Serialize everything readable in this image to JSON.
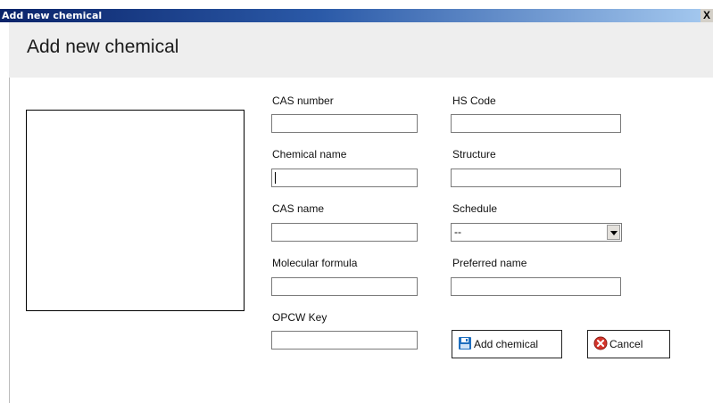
{
  "window": {
    "title": "Add new chemical",
    "close_glyph": "X"
  },
  "header": {
    "title": "Add new chemical"
  },
  "form": {
    "cas_number": {
      "label": "CAS number",
      "value": ""
    },
    "hs_code": {
      "label": "HS Code",
      "value": ""
    },
    "chemical_name": {
      "label": "Chemical name",
      "value": ""
    },
    "structure": {
      "label": "Structure",
      "value": ""
    },
    "cas_name": {
      "label": "CAS name",
      "value": ""
    },
    "schedule": {
      "label": "Schedule",
      "selected": "--"
    },
    "molecular_formula": {
      "label": "Molecular formula",
      "value": ""
    },
    "preferred_name": {
      "label": "Preferred name",
      "value": ""
    },
    "opcw_key": {
      "label": "OPCW Key",
      "value": ""
    }
  },
  "buttons": {
    "add": {
      "label": "Add chemical",
      "icon": "floppy-disk-icon"
    },
    "cancel": {
      "label": "Cancel",
      "icon": "cancel-x-icon"
    }
  },
  "colors": {
    "accent_blue": "#1f6fbf",
    "cancel_red": "#d4352b"
  }
}
